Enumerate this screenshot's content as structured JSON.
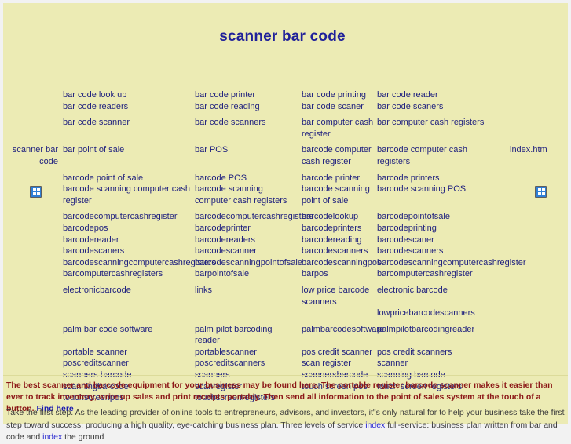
{
  "page": {
    "title": "scanner bar code",
    "background_color": "#ecebb4",
    "link_color": "#21227f",
    "title_color": "#20219a"
  },
  "edges": {
    "left_label": "scanner bar code",
    "right_label": "index.htm",
    "broken_image_icon": "broken-image-icon"
  },
  "links": {
    "rows": [
      {
        "c1": [
          "bar code look up"
        ],
        "c2": [
          "bar code printer"
        ],
        "c3": [
          "bar code printing"
        ],
        "c4": [
          "bar code reader"
        ]
      },
      {
        "c1": [
          "bar code readers"
        ],
        "c2": [
          "bar code reading"
        ],
        "c3": [
          "bar code scaner"
        ],
        "c4": [
          "bar code scaners"
        ]
      },
      {
        "c1": [
          "bar code scanner"
        ],
        "c2": [
          "bar code scanners"
        ],
        "c3": [
          "bar computer cash register"
        ],
        "c4": [
          "bar computer cash registers"
        ]
      },
      {
        "c1": [
          "bar point of sale"
        ],
        "c2": [
          "bar POS"
        ],
        "c3": [
          "barcode computer cash register"
        ],
        "c4": [
          "barcode computer cash registers"
        ]
      },
      {
        "c1": [
          "barcode point of sale"
        ],
        "c2": [
          "barcode POS"
        ],
        "c3": [
          "barcode printer"
        ],
        "c4": [
          "barcode printers"
        ]
      },
      {
        "c1": [
          "barcode scanning computer cash register"
        ],
        "c2": [
          "barcode scanning computer cash registers"
        ],
        "c3": [
          "barcode scanning point of sale"
        ],
        "c4": [
          "barcode scanning POS"
        ]
      },
      {
        "c1": [
          "barcodecomputercashregister"
        ],
        "c2": [
          "barcodecomputercashregisters"
        ],
        "c3": [
          "barcodelookup"
        ],
        "c4": [
          "barcodepointofsale"
        ]
      },
      {
        "c1": [
          "barcodepos"
        ],
        "c2": [
          "barcodeprinter"
        ],
        "c3": [
          "barcodeprinters"
        ],
        "c4": [
          "barcodeprinting"
        ]
      },
      {
        "c1": [
          "barcodereader"
        ],
        "c2": [
          "barcodereaders"
        ],
        "c3": [
          "barcodereading"
        ],
        "c4": [
          "barcodescaner"
        ]
      },
      {
        "c1": [
          "barcodescaners"
        ],
        "c2": [
          "barcodescanner"
        ],
        "c3": [
          "barcodescanners"
        ],
        "c4": [
          "barcodescanners"
        ]
      },
      {
        "c1": [
          "barcodescanningcomputercashregisters"
        ],
        "c2": [
          "barcodescanningpointofsale"
        ],
        "c3": [
          "barcodescanningpos"
        ],
        "c4": [
          "barcodescanningcomputercashregister"
        ]
      },
      {
        "c1": [
          "barcomputercashregisters"
        ],
        "c2": [
          "barpointofsale"
        ],
        "c3": [
          "barpos"
        ],
        "c4": [
          "barcomputercashregister"
        ]
      },
      {
        "c1": [
          "electronicbarcode"
        ],
        "c2": [
          "links"
        ],
        "c3": [
          "low price barcode scanners"
        ],
        "c4": [
          "electronic barcode"
        ]
      },
      {
        "c1": [
          ""
        ],
        "c2": [
          ""
        ],
        "c3": [
          ""
        ],
        "c4": [
          "lowpricebarcodescanners"
        ]
      },
      {
        "c1": [
          "palm bar code software"
        ],
        "c2": [
          "palm pilot barcoding reader"
        ],
        "c3": [
          "palmbarcodesoftware"
        ],
        "c4": [
          "palmpilotbarcodingreader"
        ]
      },
      {
        "c1": [
          "portable scanner"
        ],
        "c2": [
          "portablescanner"
        ],
        "c3": [
          "pos credit scanner"
        ],
        "c4": [
          "pos credit scanners"
        ]
      },
      {
        "c1": [
          "poscreditscanner"
        ],
        "c2": [
          "poscreditscanners"
        ],
        "c3": [
          "scan register"
        ],
        "c4": [
          "scanner"
        ]
      },
      {
        "c1": [
          "scanners barcode"
        ],
        "c2": [
          "scanners"
        ],
        "c3": [
          "scannersbarcode"
        ],
        "c4": [
          "scanning barcode"
        ]
      },
      {
        "c1": [
          "scanningbarcode"
        ],
        "c2": [
          "scanregister"
        ],
        "c3": [
          "touch screen pos"
        ],
        "c4": [
          "touch screen registers"
        ]
      },
      {
        "c1": [
          "touchscreenpos"
        ],
        "c2": [
          "touchscreenregisters"
        ],
        "c3": [
          ""
        ],
        "c4": [
          ""
        ]
      }
    ]
  },
  "footer": {
    "red_paragraph_part1": "The best scanner and barcode equipment for your business may be found here. The portable register barcode scanner makes it easier than ever to track inventory, write up sales and print receipts portably. Then send all information to the point of sales system at the touch of a button. ",
    "red_paragraph_link": "Find here",
    "gray_paragraph_part1": "Take the first step. As the leading provider of online tools to entrepreneurs, advisors, and investors, it\"s only natural for to help your business take the first step toward success: producing a high quality, eye-catching business plan. Three levels of service ",
    "gray_link_1": "index",
    "gray_paragraph_part2": " full-service: business plan written from bar and code and ",
    "gray_link_2": "index",
    "gray_paragraph_part3": " the ground"
  }
}
